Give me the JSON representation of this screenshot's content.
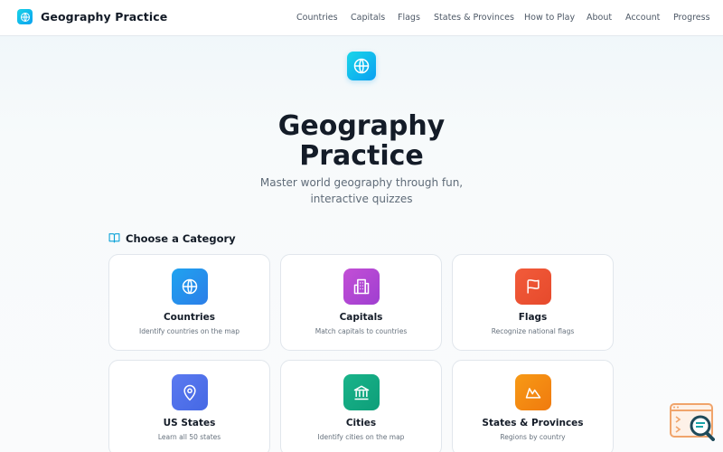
{
  "header": {
    "title": "Geography Practice",
    "nav": [
      "Countries",
      "Capitals",
      "Flags",
      "States & Provinces",
      "How to Play",
      "About",
      "Account",
      "Progress"
    ]
  },
  "hero": {
    "title_line1": "Geography",
    "title_line2": "Practice",
    "subtitle_line1": "Master world geography through fun,",
    "subtitle_line2": "interactive quizzes",
    "icon": "globe-icon"
  },
  "section": {
    "title": "Choose a Category",
    "icon": "book-open-icon"
  },
  "categories": [
    {
      "title": "Countries",
      "desc": "Identify countries on the map",
      "icon": "globe-icon",
      "color_from": "#1fa3f0",
      "color_to": "#2c7ee8"
    },
    {
      "title": "Capitals",
      "desc": "Match capitals to countries",
      "icon": "building-icon",
      "color_from": "#c34fd6",
      "color_to": "#9f3fd0"
    },
    {
      "title": "Flags",
      "desc": "Recognize national flags",
      "icon": "flag-icon",
      "color_from": "#f25b3a",
      "color_to": "#e64a2c"
    },
    {
      "title": "US States",
      "desc": "Learn all 50 states",
      "icon": "map-pin-icon",
      "color_from": "#5b7af0",
      "color_to": "#4568e4"
    },
    {
      "title": "Cities",
      "desc": "Identify cities on the map",
      "icon": "landmark-icon",
      "color_from": "#19b48a",
      "color_to": "#0e9e79"
    },
    {
      "title": "States & Provinces",
      "desc": "Regions by country",
      "icon": "mountain-icon",
      "color_from": "#f79a16",
      "color_to": "#f07a0e"
    }
  ],
  "colors": {
    "accent": "#0ba2f0",
    "widget": "#f0a46b"
  }
}
